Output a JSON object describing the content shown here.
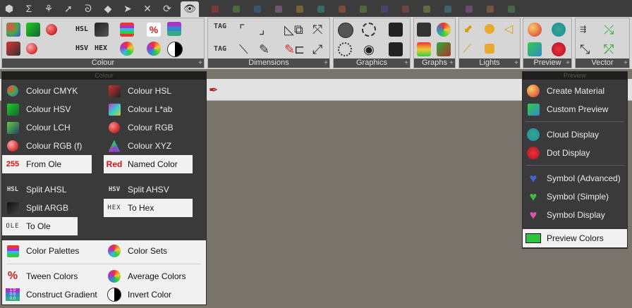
{
  "ribbon": {
    "groups": [
      {
        "label": "Colour"
      },
      {
        "label": "Dimensions"
      },
      {
        "label": "Graphics"
      },
      {
        "label": "Graphs"
      },
      {
        "label": "Lights"
      },
      {
        "label": "Preview"
      },
      {
        "label": "Vector"
      }
    ],
    "icon_texts": {
      "hsl": "HSL",
      "hsv": "HSV",
      "hex": "HEX",
      "tag": "TAG"
    }
  },
  "colour_menu": {
    "header": "Colour",
    "left": [
      {
        "label": "Colour CMYK",
        "icon": "cmyk-icon"
      },
      {
        "label": "Colour HSV",
        "icon": "hsv-cube-icon"
      },
      {
        "label": "Colour LCH",
        "icon": "lch-icon"
      },
      {
        "label": "Colour RGB (f)",
        "icon": "rgb-float-icon"
      },
      {
        "label": "From Ole",
        "icon": "from-ole-icon",
        "badge": "255"
      },
      {
        "label": "Split AHSL",
        "icon": "split-ahsl-icon",
        "badge": "HSL"
      },
      {
        "label": "Split ARGB",
        "icon": "split-argb-icon"
      },
      {
        "label": "To Ole",
        "icon": "to-ole-icon",
        "badge": "OLE"
      },
      {
        "label": "Color Palettes",
        "icon": "palettes-icon"
      },
      {
        "label": "Tween Colors",
        "icon": "tween-icon",
        "badge": "%"
      },
      {
        "label": "Construct Gradient",
        "icon": "gradient-icon"
      }
    ],
    "right": [
      {
        "label": "Colour HSL",
        "icon": "hsl-icon"
      },
      {
        "label": "Colour L*ab",
        "icon": "lab-icon"
      },
      {
        "label": "Colour RGB",
        "icon": "rgb-icon"
      },
      {
        "label": "Colour XYZ",
        "icon": "xyz-icon"
      },
      {
        "label": "Named Color",
        "icon": "named-color-icon",
        "badge": "Red"
      },
      {
        "label": "Split AHSV",
        "icon": "split-ahsv-icon",
        "badge": "HSV"
      },
      {
        "label": "To Hex",
        "icon": "to-hex-icon",
        "badge": "HEX"
      },
      {
        "label": "Color Sets",
        "icon": "color-sets-icon"
      },
      {
        "label": "Average Colors",
        "icon": "average-icon"
      },
      {
        "label": "Invert Color",
        "icon": "invert-icon"
      }
    ],
    "gradient_badge": [
      "1.0",
      "0.5",
      "0.0"
    ]
  },
  "preview_menu": {
    "header": "Preview",
    "items": [
      {
        "label": "Create Material",
        "icon": "material-icon"
      },
      {
        "label": "Custom Preview",
        "icon": "custom-preview-icon"
      },
      {
        "label": "Cloud Display",
        "icon": "cloud-icon"
      },
      {
        "label": "Dot Display",
        "icon": "dot-icon"
      },
      {
        "label": "Symbol (Advanced)",
        "icon": "symbol-advanced-icon"
      },
      {
        "label": "Symbol (Simple)",
        "icon": "symbol-simple-icon"
      },
      {
        "label": "Symbol Display",
        "icon": "symbol-display-icon"
      },
      {
        "label": "Preview Colors",
        "icon": "preview-colors-icon"
      }
    ]
  }
}
